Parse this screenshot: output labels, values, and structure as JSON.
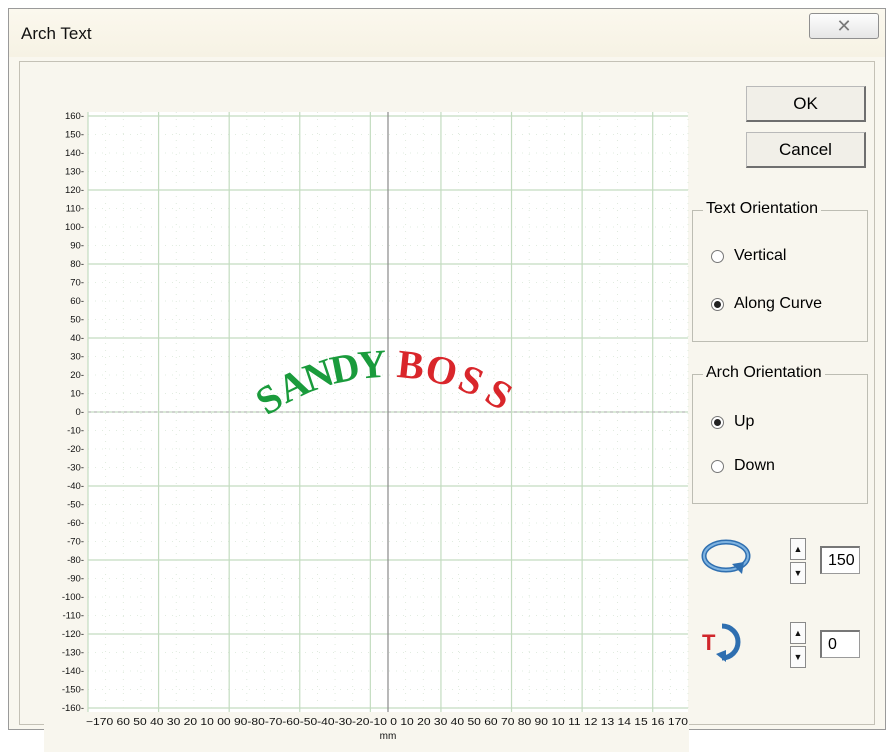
{
  "window": {
    "title": "Arch Text",
    "close_glyph": "✕"
  },
  "buttons": {
    "ok": "OK",
    "cancel": "Cancel"
  },
  "text_orientation": {
    "label": "Text Orientation",
    "options": [
      {
        "label": "Vertical",
        "checked": false
      },
      {
        "label": "Along Curve",
        "checked": true
      }
    ]
  },
  "arch_orientation": {
    "label": "Arch Orientation",
    "options": [
      {
        "label": "Up",
        "checked": true
      },
      {
        "label": "Down",
        "checked": false
      }
    ]
  },
  "radius": {
    "icon": "arch-radius-icon",
    "value": "150"
  },
  "angle": {
    "icon": "text-rotate-icon",
    "value": "0"
  },
  "graph": {
    "unit_label": "mm",
    "y_ticks": [
      "160",
      "150",
      "140",
      "130",
      "120",
      "110",
      "100",
      "90",
      "80",
      "70",
      "60",
      "50",
      "40",
      "30",
      "20",
      "10",
      "0",
      "-10",
      "-20",
      "-30",
      "-40",
      "-50",
      "-60",
      "-70",
      "-80",
      "-90",
      "-100",
      "-110",
      "-120",
      "-130",
      "-140",
      "-150",
      "-160"
    ],
    "x_labels_text": "−170 60 50 40 30 20 10 00 90-80-70-60-50-40-30-20-10 0  10 20 30 40 50 60 70 80 90 10 11 12 13 14 15 16 170",
    "arch_text_left": "SANDY",
    "arch_text_right": "BOSS",
    "colors": {
      "left": "#1a9b3c",
      "right": "#d9262b",
      "grid": "#c3dcc0"
    }
  }
}
